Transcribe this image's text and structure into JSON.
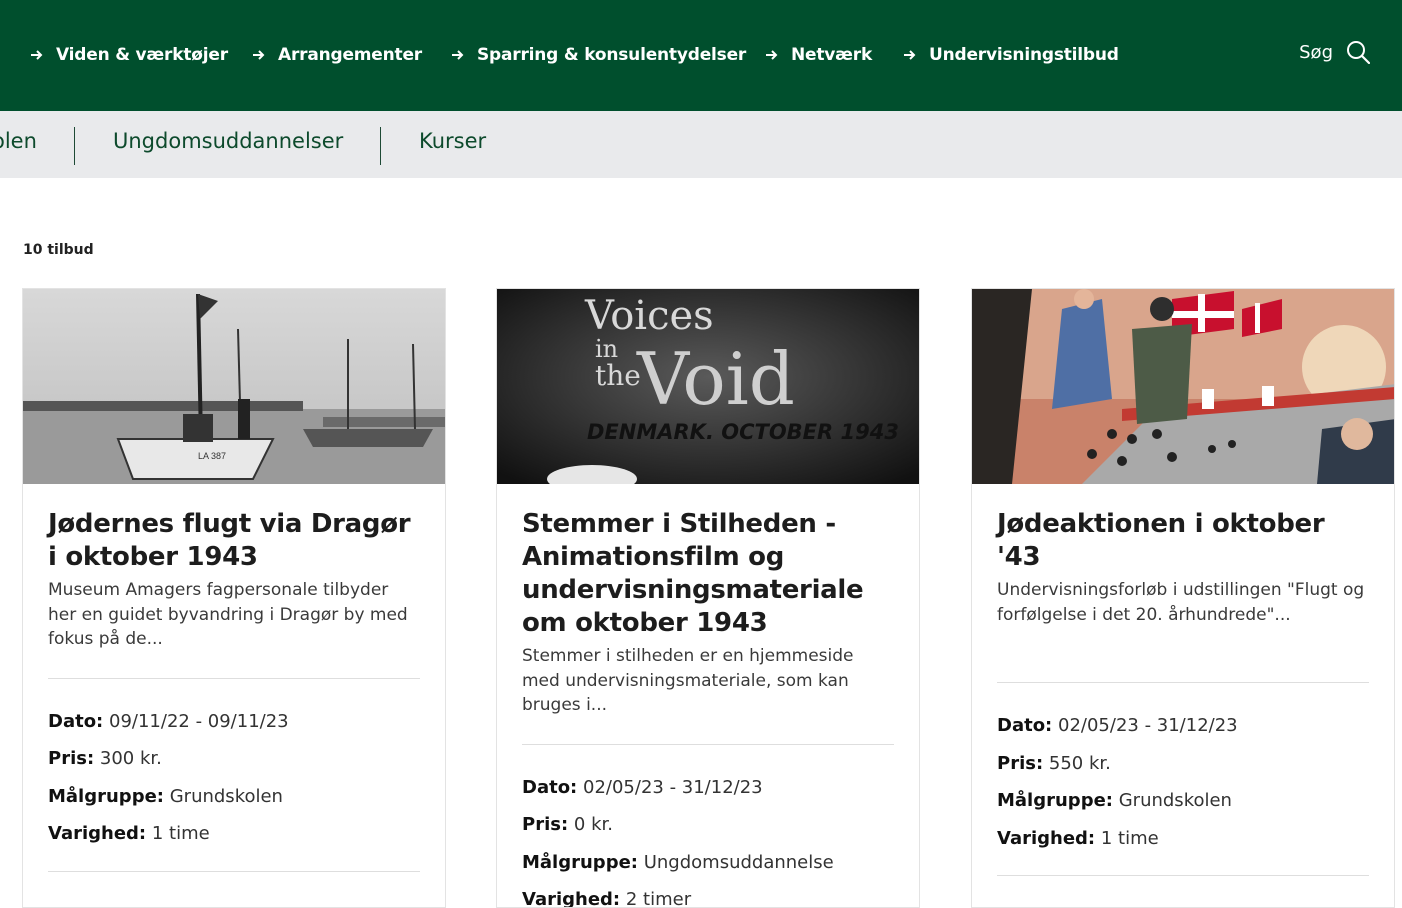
{
  "nav": {
    "items": [
      {
        "label": "Viden & værktøjer"
      },
      {
        "label": "Arrangementer"
      },
      {
        "label": "Sparring & konsulentydelser"
      },
      {
        "label": "Netværk"
      },
      {
        "label": "Undervisningstilbud"
      }
    ],
    "search_label": "Søg"
  },
  "subnav": {
    "items": [
      {
        "label": "olen"
      },
      {
        "label": "Ungdomsuddannelser"
      },
      {
        "label": "Kurser"
      }
    ]
  },
  "results": {
    "count_label": "10 tilbud"
  },
  "cards": [
    {
      "title": "Jødernes flugt via Dragør i oktober 1943",
      "description": "Museum Amagers fagpersonale tilbyder her en guidet byvandring i Dragør by med fokus på de...",
      "date_label": "Dato:",
      "date": "09/11/22 - 09/11/23",
      "price_label": "Pris:",
      "price": "300 kr.",
      "audience_label": "Målgruppe:",
      "audience": "Grundskolen",
      "duration_label": "Varighed:",
      "duration": "1 time",
      "image": {
        "title_lines": [
          "LA 387"
        ]
      }
    },
    {
      "title": "Stemmer i Stilheden - Animationsfilm og undervisningsmateriale om oktober 1943",
      "description": "Stemmer i stilheden er en hjemmeside med undervisningsmateriale, som kan bruges i...",
      "date_label": "Dato:",
      "date": "02/05/23 - 31/12/23",
      "price_label": "Pris:",
      "price": "0 kr.",
      "audience_label": "Målgruppe:",
      "audience": "Ungdomsuddannelse",
      "duration_label": "Varighed:",
      "duration": "2 timer",
      "image": {
        "voices": "Voices",
        "in": "in",
        "the": "the",
        "void": "Void",
        "sub": "DENMARK. OCTOBER 1943"
      }
    },
    {
      "title": "Jødeaktionen i oktober '43",
      "description": "Undervisningsforløb i udstillingen \"Flugt og forfølgelse i det 20. århundrede\"...",
      "date_label": "Dato:",
      "date": "02/05/23 - 31/12/23",
      "price_label": "Pris:",
      "price": "550 kr.",
      "audience_label": "Målgruppe:",
      "audience": "Grundskolen",
      "duration_label": "Varighed:",
      "duration": "1 time"
    }
  ],
  "colors": {
    "brand_green": "#004f2d",
    "subnav_bg": "#e9eaec"
  }
}
